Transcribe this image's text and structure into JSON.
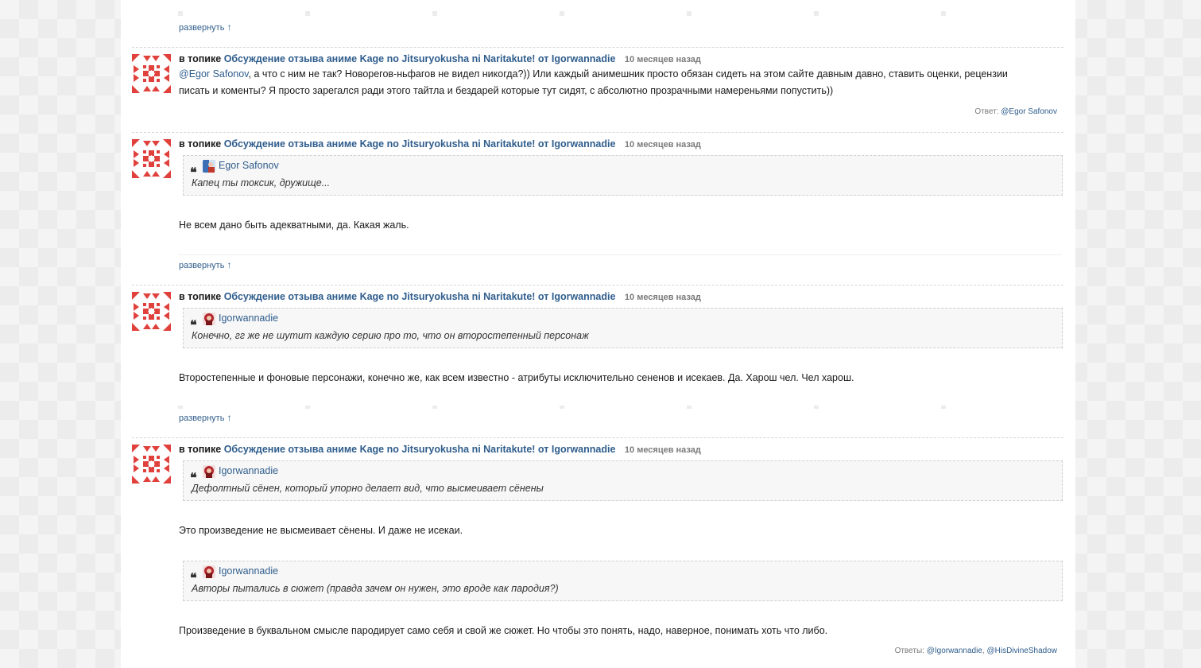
{
  "expand_label": "развернуть",
  "expand_arrow": "↑",
  "comments": [
    {
      "prefix": "в топике",
      "topic": "Обсуждение отзыва аниме Kage no Jitsuryokusha ni Naritakute! от Igorwannadie",
      "time": "10 месяцев назад",
      "mention": "@Egor Safonov",
      "text": ", а что с ним не так? Новорегов-ньфагов не видел никогда?)) Или каждый анимешник просто обязан сидеть на этом сайте давным давно, ставить оценки, рецензии",
      "text2": "писать и коменты? Я просто зарегался ради этого тайтла и бездарей которые тут сидят, с абсолютно прозрачными намереньями попустить))",
      "reply_label": "Ответ:",
      "reply_links": [
        "@Egor Safonov"
      ]
    },
    {
      "prefix": "в топике",
      "topic": "Обсуждение отзыва аниме Kage no Jitsuryokusha ni Naritakute! от Igorwannadie",
      "time": "10 месяцев назад",
      "quote_author": "Egor Safonov",
      "quote_text": "Капец ты токсик, дружище...",
      "text": "Не всем дано быть адекватными, да. Какая жаль."
    },
    {
      "prefix": "в топике",
      "topic": "Обсуждение отзыва аниме Kage no Jitsuryokusha ni Naritakute! от Igorwannadie",
      "time": "10 месяцев назад",
      "quote_author": "Igorwannadie",
      "quote_text": "Конечно, гг же не шутит каждую серию про то, что он второстепенный персонаж",
      "text": "Второстепенные и фоновые персонажи, конечно же, как всем известно - атрибуты исключительно сененов и исекаев. Да. Харош чел. Чел харош."
    },
    {
      "prefix": "в топике",
      "topic": "Обсуждение отзыва аниме Kage no Jitsuryokusha ni Naritakute! от Igorwannadie",
      "time": "10 месяцев назад",
      "quote_author": "Igorwannadie",
      "quote_text": "Дефолтный сёнен, который упорно делает вид, что высмеивает сёнены",
      "text": "Это произведение не высмеивает сёнены. И даже не исекаи.",
      "quote2_author": "Igorwannadie",
      "quote2_text": "Авторы пытались в сюжет (правда зачем он нужен, это вроде как пародия?)",
      "text2": "Произведение в буквальном смысле пародирует само себя и свой же сюжет. Но чтобы это понять, надо, наверное, понимать хоть что либо.",
      "reply_label": "Ответы:",
      "reply_links": [
        "@Igorwannadie",
        "@HisDivineShadow"
      ]
    }
  ]
}
